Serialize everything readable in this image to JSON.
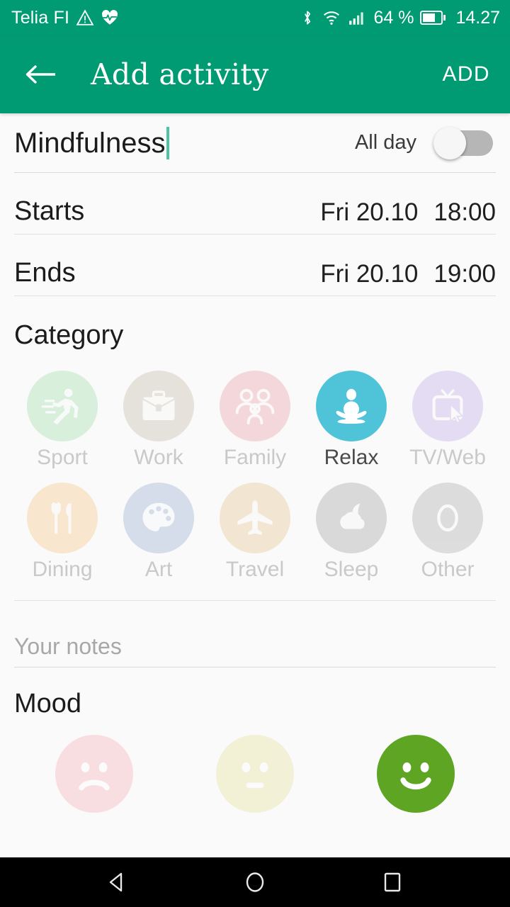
{
  "status_bar": {
    "carrier": "Telia FI",
    "battery_percent": "64 %",
    "clock": "14.27",
    "icons": [
      "warning-triangle-icon",
      "heartbeat-icon",
      "bluetooth-icon",
      "wifi-icon",
      "cellular-signal-icon",
      "battery-icon"
    ],
    "background_color": "#009b72"
  },
  "app_bar": {
    "back_label": "←",
    "title": "Add activity",
    "action_label": "ADD"
  },
  "form": {
    "activity_title_value": "Mindfulness",
    "activity_title_placeholder": "Activity name",
    "all_day_label": "All day",
    "all_day_on": false,
    "starts_label": "Starts",
    "starts_date": "Fri 20.10",
    "starts_time": "18:00",
    "ends_label": "Ends",
    "ends_date": "Fri 20.10",
    "ends_time": "19:00",
    "notes_placeholder": "Your notes",
    "notes_value": ""
  },
  "category": {
    "heading": "Category",
    "selected": "Relax",
    "items": [
      {
        "label": "Sport",
        "icon": "running-icon",
        "color": "#8dd69a",
        "selected": false
      },
      {
        "label": "Work",
        "icon": "briefcase-icon",
        "color": "#b8a895",
        "selected": false
      },
      {
        "label": "Family",
        "icon": "family-icon",
        "color": "#e88a92",
        "selected": false
      },
      {
        "label": "Relax",
        "icon": "meditation-icon",
        "color": "#4fc4d9",
        "selected": true
      },
      {
        "label": "TV/Web",
        "icon": "tv-cursor-icon",
        "color": "#b49ae0",
        "selected": false
      },
      {
        "label": "Dining",
        "icon": "cutlery-icon",
        "color": "#f5b96a",
        "selected": false
      },
      {
        "label": "Art",
        "icon": "palette-icon",
        "color": "#7f9dc4",
        "selected": false
      },
      {
        "label": "Travel",
        "icon": "airplane-icon",
        "color": "#e0b678",
        "selected": false
      },
      {
        "label": "Sleep",
        "icon": "moon-cloud-icon",
        "color": "#8f8f8f",
        "selected": false
      },
      {
        "label": "Other",
        "icon": "letter-o-icon",
        "color": "#9a9a9a",
        "selected": false
      }
    ]
  },
  "mood": {
    "heading": "Mood",
    "selected": "happy",
    "items": [
      {
        "name": "sad",
        "icon": "sad-face-icon",
        "color": "#f4a8ad",
        "selected": false
      },
      {
        "name": "neutral",
        "icon": "neutral-face-icon",
        "color": "#e3df8e",
        "selected": false
      },
      {
        "name": "happy",
        "icon": "happy-face-icon",
        "color": "#5fa524",
        "selected": true
      }
    ]
  },
  "nav_bar": {
    "back": "back-triangle-icon",
    "home": "home-circle-icon",
    "recents": "recents-square-icon"
  }
}
